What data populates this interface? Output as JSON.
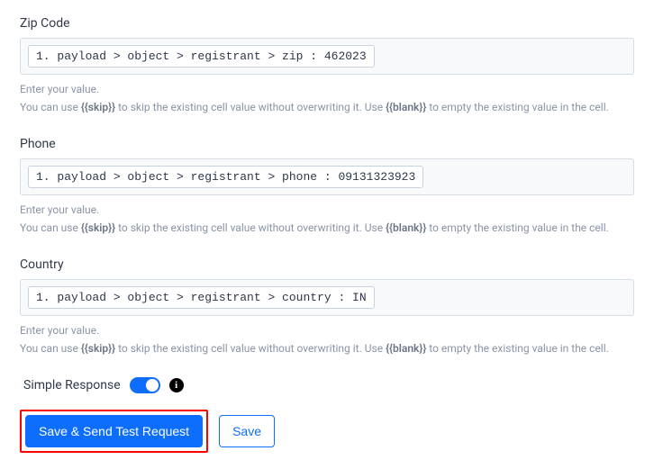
{
  "fields": [
    {
      "label": "Zip Code",
      "mapping": "1. payload > object > registrant > zip : 462023"
    },
    {
      "label": "Phone",
      "mapping": "1. payload > object > registrant > phone : 09131323923"
    },
    {
      "label": "Country",
      "mapping": "1. payload > object > registrant > country : IN"
    }
  ],
  "hint_line1": "Enter your value.",
  "hint_line2_pre": "You can use ",
  "hint_skip": "{{skip}}",
  "hint_line2_mid": " to skip the existing cell value without overwriting it. Use ",
  "hint_blank": "{{blank}}",
  "hint_line2_post": " to empty the existing value in the cell.",
  "toggle": {
    "label": "Simple Response",
    "info": "i"
  },
  "buttons": {
    "primary": "Save & Send Test Request",
    "secondary": "Save"
  }
}
